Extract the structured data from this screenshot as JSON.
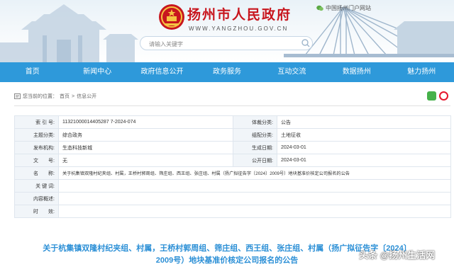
{
  "header": {
    "site_title": "扬州市人民政府",
    "site_url": "WWW.YANGZHOU.GOV.CN",
    "portal_link": "中国扬州门户网站",
    "search_placeholder": "请输入关键字"
  },
  "nav": {
    "items": [
      "首页",
      "新闻中心",
      "政府信息公开",
      "政务服务",
      "互动交流",
      "数据扬州",
      "魅力扬州"
    ]
  },
  "breadcrumb": {
    "prefix": "您当前的位置：",
    "home": "首页",
    "sep": ">",
    "current": "信息公开"
  },
  "info_table": {
    "index_label": "索 引 号:",
    "index_value": "11321000014405287 7-2024-074",
    "type_label": "体裁分类:",
    "type_value": "公告",
    "topic_label": "主题分类:",
    "topic_value": "综合政务",
    "org_category_label": "组配分类:",
    "org_category_value": "土地征收",
    "publisher_label": "发布机构:",
    "publisher_value": "生态科技新城",
    "created_label": "生成日期:",
    "created_value": "2024-03-01",
    "doc_no_label": "文　　号:",
    "doc_no_value": "无",
    "publish_date_label": "公开日期:",
    "publish_date_value": "2024-03-01",
    "name_label": "名　　称:",
    "name_value": "关于杭集镇双隆村纪夹组、村属，王桥村郭周组、筛庄组、西王组、张庄组、村属（扬广拟征告字〔2024〕2009号）地块基准价核定公司报名的公告",
    "keyword_label": "关 键 词:",
    "keyword_value": "",
    "summary_label": "内容概述:",
    "summary_value": "",
    "timeliness_label": "时　　效:",
    "timeliness_value": ""
  },
  "document": {
    "title_line1": "关于杭集镇双隆村纪夹组、村属，王桥村郭周组、筛庄组、西王组、张庄组、村属（扬广拟征告字〔2024〕",
    "title_line2": "2009号）地块基准价核定公司报名的公告"
  },
  "watermark": "头条 @扬州生活网",
  "colors": {
    "nav_bg": "#2e99da",
    "title_red": "#c8161e",
    "doc_title_blue": "#2b8fd6"
  }
}
